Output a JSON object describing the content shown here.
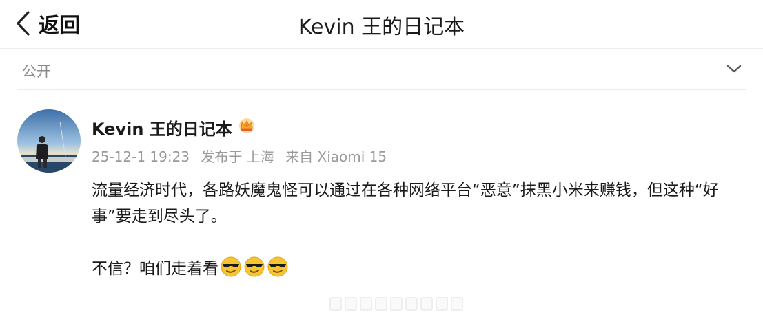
{
  "navbar": {
    "back_label": "返回",
    "title": "Kevin 王的日记本",
    "back_icon": "chevron-left-icon"
  },
  "visibility": {
    "label": "公开",
    "chevron_icon": "chevron-down-icon"
  },
  "post": {
    "author": "Kevin 王的日记本",
    "badge_icon": "vip-crown-icon",
    "timestamp": "25-12-1 19:23",
    "location": "发布于 上海",
    "device": "来自 Xiaomi 15",
    "paragraph1": "流量经济时代，各路妖魔鬼怪可以通过在各种网络平台“恶意”抹黑小米来赚钱，但这种“好事”要走到尽头了。",
    "paragraph2": "不信？咱们走着看",
    "emojis": [
      "cool-face-emoji",
      "cool-face-emoji",
      "cool-face-emoji"
    ]
  },
  "colors": {
    "text": "#1a1a1a",
    "muted": "#9a9a9a",
    "divider": "#ececec",
    "emoji_face": "#f7c531"
  }
}
